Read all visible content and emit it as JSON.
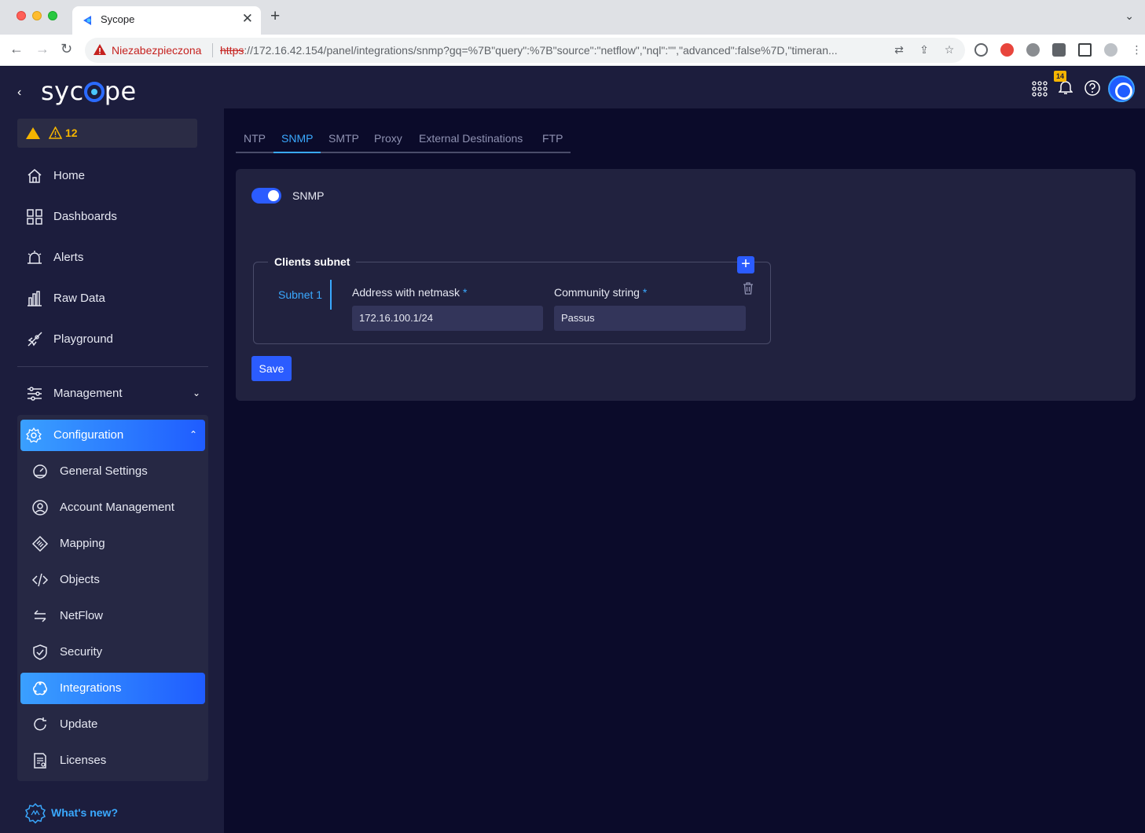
{
  "browser": {
    "tab_title": "Sycope",
    "security_label": "Niezabezpieczona",
    "url_scheme": "https",
    "url_rest": "://172.16.42.154/panel/integrations/snmp?gq=%7B\"query\":%7B\"source\":\"netflow\",\"nql\":\"\",\"advanced\":false%7D,\"timeran..."
  },
  "sidebar": {
    "logo_left": "syc",
    "logo_right": "pe",
    "alert_count": "12",
    "nav": [
      {
        "label": "Home",
        "icon": "home-icon"
      },
      {
        "label": "Dashboards",
        "icon": "dashboards-icon"
      },
      {
        "label": "Alerts",
        "icon": "alerts-icon"
      },
      {
        "label": "Raw Data",
        "icon": "raw-data-icon"
      },
      {
        "label": "Playground",
        "icon": "playground-icon"
      }
    ],
    "management_label": "Management",
    "configuration_label": "Configuration",
    "config_items": [
      {
        "label": "General Settings",
        "icon": "general-settings-icon"
      },
      {
        "label": "Account Management",
        "icon": "account-management-icon"
      },
      {
        "label": "Mapping",
        "icon": "mapping-icon"
      },
      {
        "label": "Objects",
        "icon": "objects-icon"
      },
      {
        "label": "NetFlow",
        "icon": "netflow-icon"
      },
      {
        "label": "Security",
        "icon": "security-icon"
      },
      {
        "label": "Integrations",
        "icon": "integrations-icon",
        "active": true
      },
      {
        "label": "Update",
        "icon": "update-icon"
      },
      {
        "label": "Licenses",
        "icon": "licenses-icon"
      }
    ],
    "whats_new": "What's new?"
  },
  "topbar": {
    "notification_count": "14"
  },
  "tabs": [
    "NTP",
    "SNMP",
    "SMTP",
    "Proxy",
    "External Destinations",
    "FTP"
  ],
  "active_tab": "SNMP",
  "snmp": {
    "toggle_label": "SNMP",
    "enabled": true,
    "fieldset_title": "Clients subnet",
    "subnet_label": "Subnet 1",
    "address_label": "Address with netmask",
    "address_value": "172.16.100.1/24",
    "community_label": "Community string",
    "community_value": "Passus",
    "required_mark": "*",
    "save_label": "Save"
  },
  "colors": {
    "accent": "#2b5cff",
    "link": "#3aa9ff",
    "warning": "#f5b500",
    "sidebar_bg": "#1c1d3d",
    "page_bg": "#0b0b2a"
  }
}
